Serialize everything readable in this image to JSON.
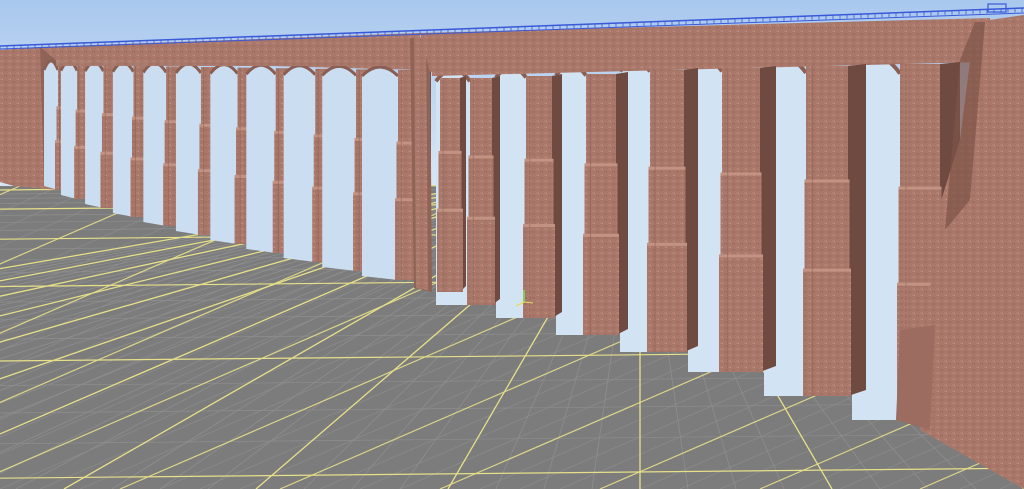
{
  "viewport": {
    "sky_top": "#a9c8ee",
    "sky_bottom": "#dbe8f5",
    "ground": "#7c7c7c",
    "minor_grid": "#8e8e8e",
    "major_grid": "#e6e08a",
    "brick": "#a9786a",
    "brick_dark": "#8a5e52",
    "brick_shadow": "#6f4a40",
    "brick_light": "#c29282",
    "rail_blue": "#3a59d8"
  },
  "viaduct": {
    "near_arch_count": 10,
    "far_arch_count": 11,
    "pier_tiers": 3
  }
}
